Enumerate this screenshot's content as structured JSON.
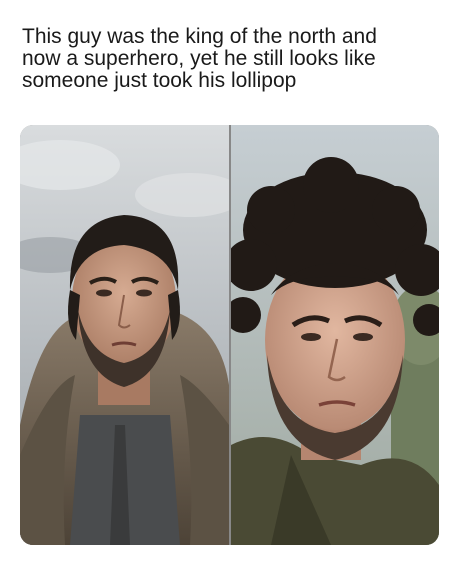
{
  "meme": {
    "caption_lines": [
      "This guy was the king of the north and",
      "now a superhero, yet he still looks like",
      "someone just took his lollipop"
    ]
  },
  "photos": [
    {
      "name": "left-photo",
      "subject": "bearded-man-in-fur-cloak-icon"
    },
    {
      "name": "right-photo",
      "subject": "bearded-man-in-olive-jacket-icon"
    }
  ],
  "colors": {
    "background": "#ffffff",
    "caption_text": "#1a1a1a",
    "left_sky": "#c9cdd0",
    "right_sky": "#b8c2c8",
    "fur": "#6e6254",
    "skin": "#c89a82",
    "hair": "#2a2420",
    "jacket": "#4a4a34"
  }
}
